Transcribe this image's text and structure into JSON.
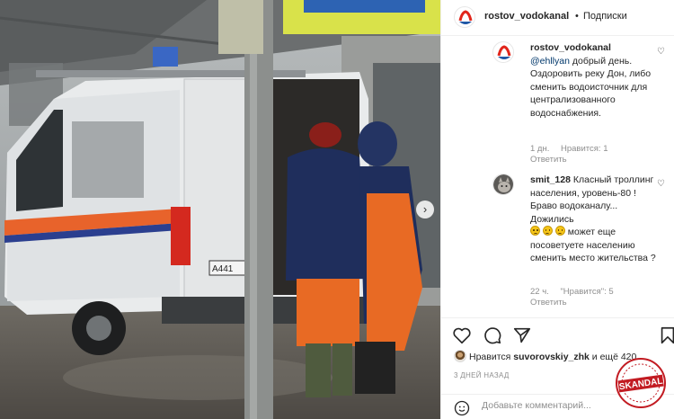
{
  "photo": {
    "plate_text": "А441",
    "van_side_text": "",
    "next_icon": "chevron-right-icon"
  },
  "header": {
    "username": "rostov_vodokanal",
    "dot": "•",
    "follow_label": "Подписки"
  },
  "comments": [
    {
      "username": "rostov_vodokanal",
      "mention": "@ehllyan",
      "text": " добрый день. Оздоровить реку Дон, либо сменить водоисточник для централизованного водоснабжения.",
      "time": "1 дн.",
      "likes": "Нравится: 1",
      "reply": "Ответить"
    },
    {
      "username": "smit_128",
      "text_before": " Класный троллинг населения, уровень-80 ! Браво водоканалу... Дожились",
      "text_after": " может еще посоветуете населению сменить место жительства ?",
      "time": "22 ч.",
      "likes": "\"Нравится\": 5",
      "reply": "Ответить"
    }
  ],
  "actions": {
    "like_icon": "heart-icon",
    "comment_icon": "comment-icon",
    "share_icon": "paper-plane-icon",
    "save_icon": "bookmark-icon"
  },
  "likes": {
    "prefix": "Нравится ",
    "user": "suvorovskiy_zhk",
    "suffix": " и ещё 420"
  },
  "time": "3 ДНЕЙ НАЗАД",
  "add_comment": {
    "placeholder": "Добавьте комментарий..."
  },
  "watermark": {
    "text": "SKANDAL"
  },
  "colors": {
    "brand_red": "#e1251b",
    "van_stripe_orange": "#e8632b",
    "van_stripe_blue": "#2b3f8f",
    "suit_orange": "#e86a24",
    "jacket_navy": "#1f2e5c"
  }
}
